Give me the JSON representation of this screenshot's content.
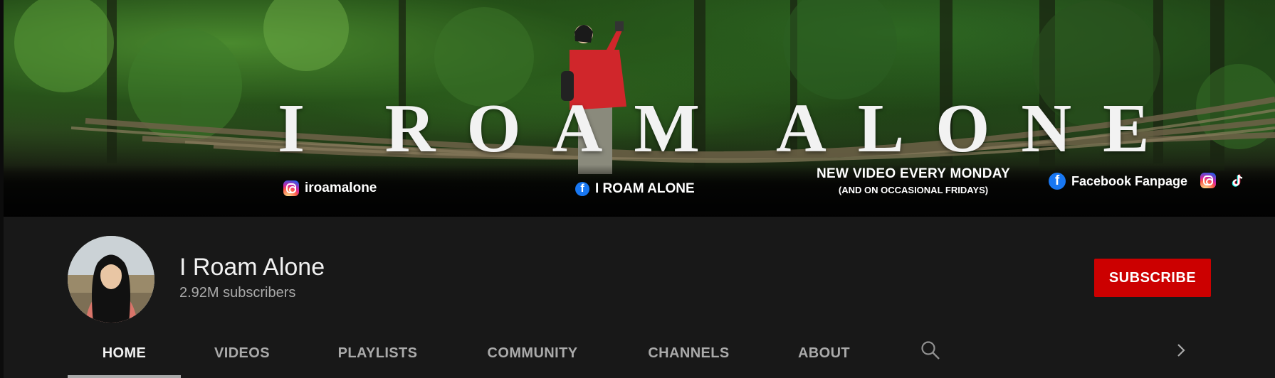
{
  "banner": {
    "title": "I ROAM ALONE",
    "instagram_handle": "iroamalone",
    "facebook_name": "I ROAM ALONE",
    "schedule_line1": "NEW VIDEO EVERY MONDAY",
    "schedule_line2": "(AND ON OCCASIONAL FRIDAYS)",
    "facebook_fanpage": "Facebook Fanpage",
    "icons": [
      "instagram-icon",
      "facebook-icon",
      "facebook-icon",
      "instagram-icon",
      "tiktok-icon"
    ]
  },
  "channel": {
    "name": "I Roam Alone",
    "subscribers": "2.92M subscribers",
    "subscribe_label": "SUBSCRIBE"
  },
  "tabs": [
    {
      "label": "HOME",
      "active": true
    },
    {
      "label": "VIDEOS",
      "active": false
    },
    {
      "label": "PLAYLISTS",
      "active": false
    },
    {
      "label": "COMMUNITY",
      "active": false
    },
    {
      "label": "CHANNELS",
      "active": false
    },
    {
      "label": "ABOUT",
      "active": false
    }
  ],
  "colors": {
    "background": "#181818",
    "subscribe": "#cc0000",
    "active_tab": "#f1f1f1",
    "inactive_tab": "#aaaaaa"
  }
}
